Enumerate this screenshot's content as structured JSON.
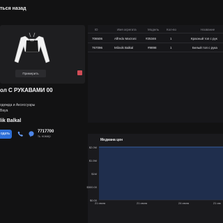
{
  "header": {
    "back_label": "ться назад"
  },
  "product": {
    "preview_label": "Примерить",
    "title": "ол С РУКАВАМИ 00",
    "category": "одежда и Аксессуары",
    "brand": "Baya",
    "seller": "lik Balkal",
    "contact_label": "одать",
    "phone": "7717700",
    "phone_note": "ть номер"
  },
  "table": {
    "columns": [
      "ID",
      "Имя агрегата",
      "Модель",
      "Кол-во",
      "Название"
    ],
    "rows": [
      [
        "706506",
        "Alfredo Marzoni",
        "#25346",
        "1",
        "Красный топ с рук"
      ],
      [
        "767096",
        "Milovik Balkal",
        "#9898",
        "1",
        "Белый топ с рука"
      ]
    ]
  },
  "chart": {
    "title": "Медиана цен"
  },
  "chart_data": {
    "type": "area",
    "title": "Медиана цен",
    "x_tick_labels": [
      "21 июля",
      "21 июля",
      "24 июля",
      "21 ию"
    ],
    "y_tick_labels": [
      "$2.0M",
      "$1.5M",
      "$1M",
      "$500.00",
      "$0.00"
    ],
    "ylim": [
      0,
      2000000
    ],
    "x": [
      "21 июля",
      "21 июля",
      "24 июля",
      "21 ию"
    ],
    "values": [
      2000000,
      2000000,
      2000000,
      2000000
    ],
    "colors": {
      "fill": "#1f2e4d",
      "line": "#3f6fc2"
    },
    "grid": false
  },
  "colors": {
    "accent": "#2d6fd8",
    "badge": "#d24d57"
  }
}
